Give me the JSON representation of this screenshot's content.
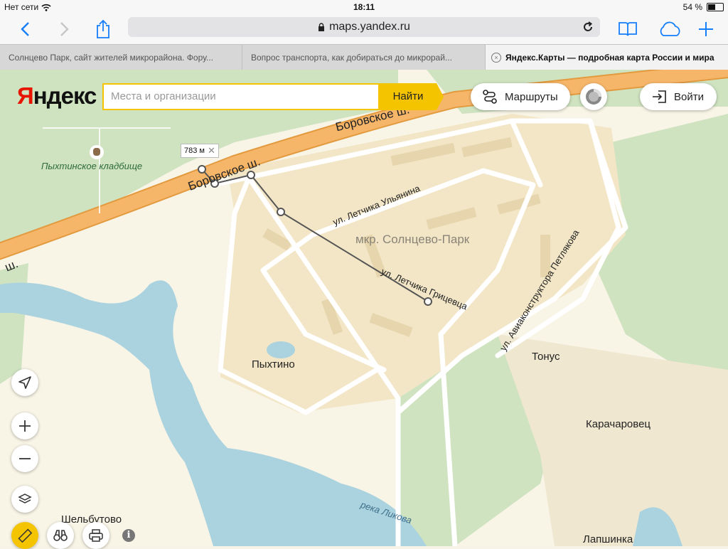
{
  "status_bar": {
    "carrier": "Нет сети",
    "time": "18:11",
    "battery_text": "54 %",
    "battery_level": 0.54
  },
  "browser": {
    "url": "maps.yandex.ru"
  },
  "tabs": [
    {
      "label": "Солнцево Парк, сайт жителей микрорайона. Фору..."
    },
    {
      "label": "Вопрос транспорта, как добираться до микрорай..."
    },
    {
      "label": "Яндекс.Карты — подробная карта России и мира"
    }
  ],
  "header": {
    "logo_first": "Я",
    "logo_rest": "ндекс",
    "search_placeholder": "Места и организации",
    "search_button": "Найти",
    "routes_button": "Маршруты",
    "login_button": "Войти"
  },
  "map": {
    "distance_label": "783 м",
    "labels": {
      "cemetery": "Пыхтинское кладбище",
      "highway_1": "Боровское ш.",
      "highway_2": "Боровское ш.",
      "highway_3": "ш.",
      "street_ulyanina": "ул. Летчика Ульянина",
      "district": "мкр. Солнцево-Парк",
      "street_gritsevtsa": "ул. Летчика Грицевца",
      "street_petlyakova": "ул. Авиаконструктора Петлякова",
      "pykhtino": "Пыхтино",
      "tonus": "Тонус",
      "karacharovets": "Карачаровец",
      "river": "река Ликова",
      "shelbutovo": "Шельбутово",
      "lapshinka": "Лапшинка"
    }
  }
}
